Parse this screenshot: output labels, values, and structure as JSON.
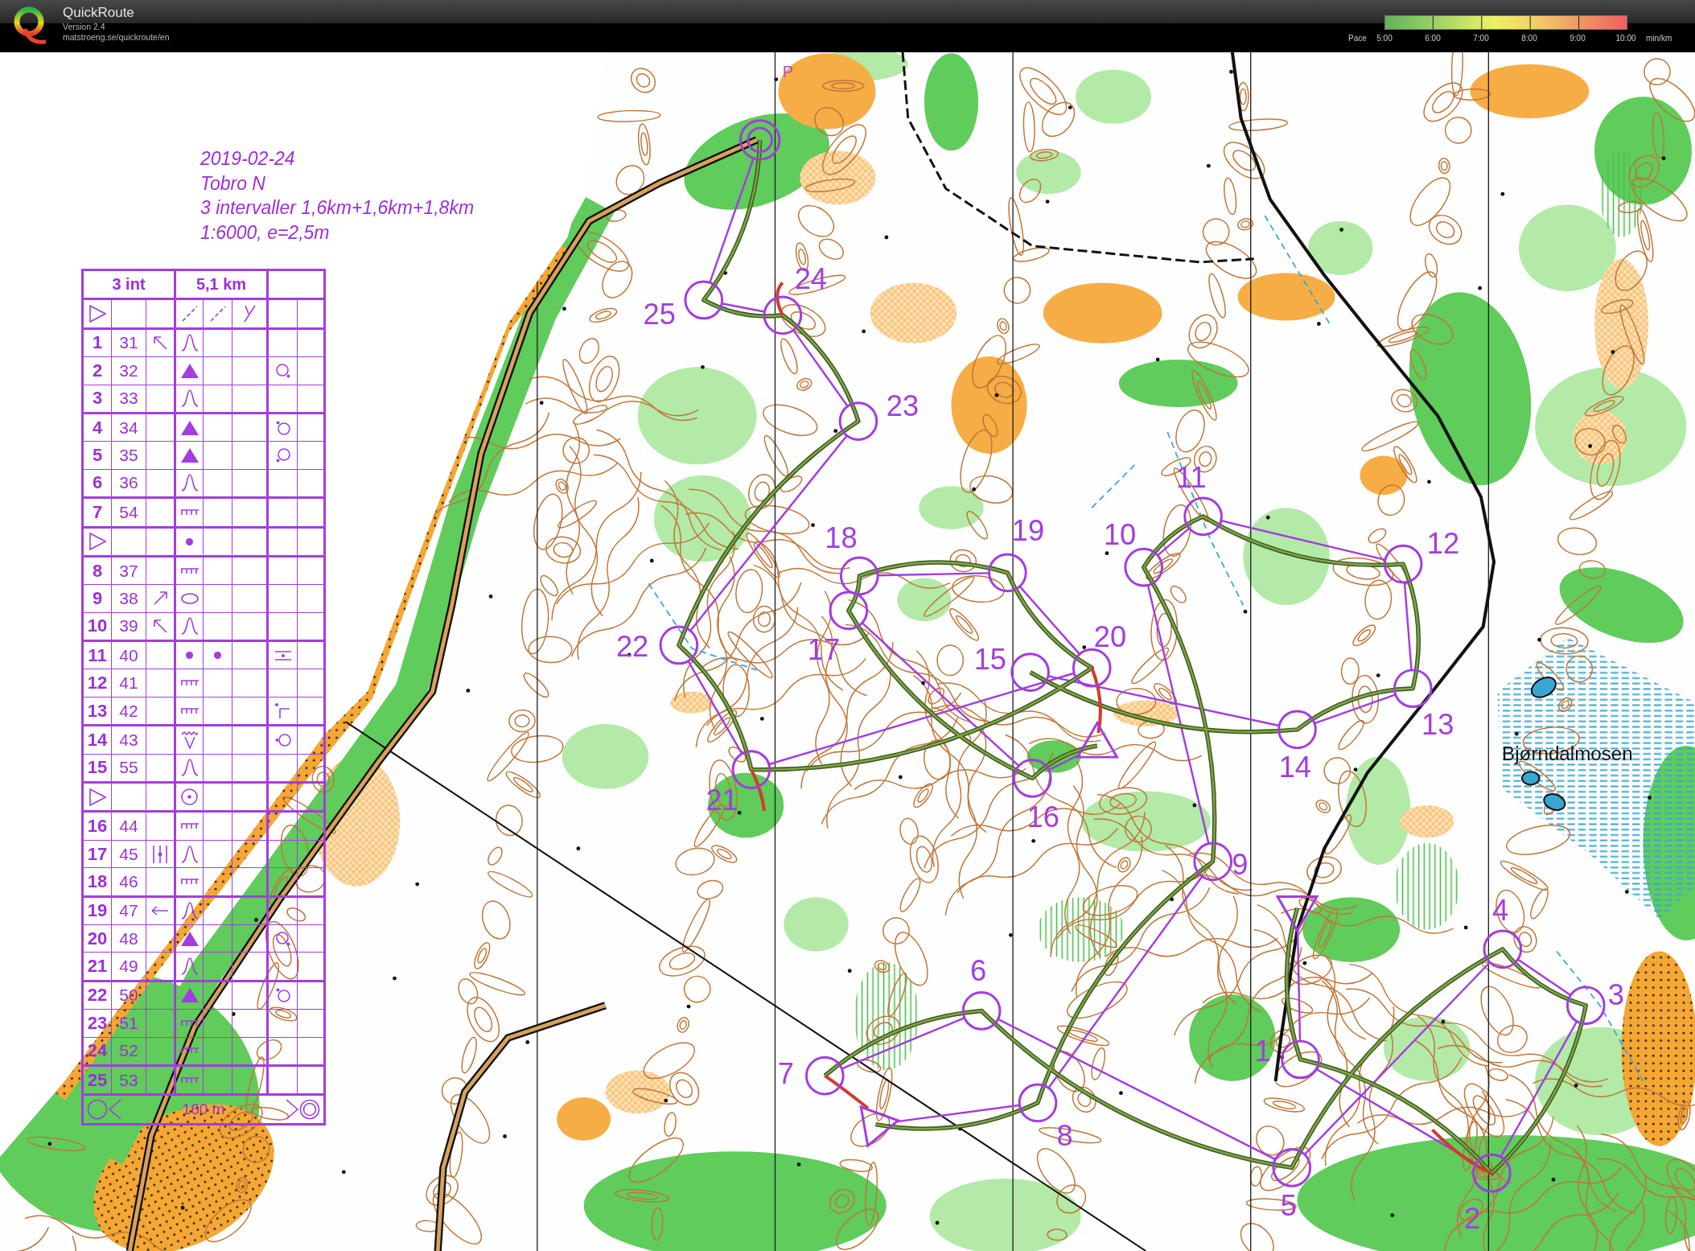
{
  "header": {
    "title": "QuickRoute",
    "version": "Version 2.4",
    "url": "matstroeng.se/quickroute/en",
    "pace_legend": {
      "label": "Pace",
      "ticks": [
        "5:00",
        "6:00",
        "7:00",
        "8:00",
        "9:00",
        "10:00"
      ],
      "unit": "min/km"
    }
  },
  "map": {
    "notes": [
      "2019-02-24",
      "Tobro N",
      "3 intervaller 1,6km+1,6km+1,8km",
      "1:6000, e=2,5m"
    ],
    "place_names": [
      "Bjørndalmosen"
    ],
    "map_letter": "P",
    "control_numbers": [
      "1",
      "2",
      "3",
      "4",
      "5",
      "6",
      "7",
      "8",
      "9",
      "10",
      "11",
      "12",
      "13",
      "14",
      "15",
      "16",
      "17",
      "18",
      "19",
      "20",
      "21",
      "22",
      "23",
      "24",
      "25"
    ]
  },
  "control_descriptions": {
    "course": "3 int",
    "length": "5,1 km",
    "rows": [
      {
        "kind": "start",
        "column_4": {
          "kind": "path"
        },
        "column_5": {
          "kind": "path"
        },
        "column_6": {
          "kind": "junction"
        }
      },
      {
        "kind": "control",
        "number": "1",
        "code": "31",
        "column_3": {
          "kind": "arrow_nw"
        },
        "column_4": {
          "kind": "knoll"
        }
      },
      {
        "kind": "control",
        "number": "2",
        "code": "32",
        "column_4": {
          "kind": "boulder"
        },
        "column_7": {
          "kind": "side_se"
        }
      },
      {
        "kind": "control",
        "number": "3",
        "code": "33",
        "column_4": {
          "kind": "knoll"
        }
      },
      {
        "kind": "control",
        "number": "4",
        "code": "34",
        "column_4": {
          "kind": "boulder"
        },
        "column_7": {
          "kind": "side_nw"
        }
      },
      {
        "kind": "control",
        "number": "5",
        "code": "35",
        "column_4": {
          "kind": "boulder"
        },
        "column_7": {
          "kind": "side_sw"
        }
      },
      {
        "kind": "control",
        "number": "6",
        "code": "36",
        "column_4": {
          "kind": "knoll"
        }
      },
      {
        "kind": "control",
        "number": "7",
        "code": "54",
        "column_4": {
          "kind": "cliff"
        }
      },
      {
        "kind": "start",
        "column_4": {
          "kind": "dot"
        }
      },
      {
        "kind": "control",
        "number": "8",
        "code": "37",
        "column_4": {
          "kind": "cliff"
        }
      },
      {
        "kind": "control",
        "number": "9",
        "code": "38",
        "column_3": {
          "kind": "arrow_ne"
        },
        "column_4": {
          "kind": "oval"
        }
      },
      {
        "kind": "control",
        "number": "10",
        "code": "39",
        "column_3": {
          "kind": "arrow_nw"
        },
        "column_4": {
          "kind": "knoll"
        }
      },
      {
        "kind": "control",
        "number": "11",
        "code": "40",
        "column_4": {
          "kind": "dot"
        },
        "column_5": {
          "kind": "dot"
        },
        "column_7": {
          "kind": "between"
        }
      },
      {
        "kind": "control",
        "number": "12",
        "code": "41",
        "column_4": {
          "kind": "cliff"
        }
      },
      {
        "kind": "control",
        "number": "13",
        "code": "42",
        "column_4": {
          "kind": "cliff"
        },
        "column_7": {
          "kind": "corner"
        }
      },
      {
        "kind": "control",
        "number": "14",
        "code": "43",
        "column_4": {
          "kind": "gully"
        },
        "column_7": {
          "kind": "side_w"
        }
      },
      {
        "kind": "control",
        "number": "15",
        "code": "55",
        "column_4": {
          "kind": "knoll"
        }
      },
      {
        "kind": "start",
        "column_4": {
          "kind": "ring"
        }
      },
      {
        "kind": "control",
        "number": "16",
        "code": "44",
        "column_4": {
          "kind": "cliff"
        }
      },
      {
        "kind": "control",
        "number": "17",
        "code": "45",
        "column_3": {
          "kind": "middle"
        },
        "column_4": {
          "kind": "knoll"
        }
      },
      {
        "kind": "control",
        "number": "18",
        "code": "46",
        "column_4": {
          "kind": "cliff"
        }
      },
      {
        "kind": "control",
        "number": "19",
        "code": "47",
        "column_3": {
          "kind": "arrow_w"
        },
        "column_4": {
          "kind": "knoll"
        }
      },
      {
        "kind": "control",
        "number": "20",
        "code": "48",
        "column_4": {
          "kind": "boulder"
        },
        "column_7": {
          "kind": "side_se"
        }
      },
      {
        "kind": "control",
        "number": "21",
        "code": "49",
        "column_4": {
          "kind": "knoll"
        }
      },
      {
        "kind": "control",
        "number": "22",
        "code": "50",
        "column_4": {
          "kind": "boulder"
        },
        "column_7": {
          "kind": "side_nw"
        }
      },
      {
        "kind": "control",
        "number": "23",
        "code": "51",
        "column_4": {
          "kind": "cliff"
        }
      },
      {
        "kind": "control",
        "number": "24",
        "code": "52",
        "column_4": {
          "kind": "cliff"
        }
      },
      {
        "kind": "control",
        "number": "25",
        "code": "53",
        "column_4": {
          "kind": "cliff"
        }
      }
    ],
    "finish_distance": "160 m"
  }
}
